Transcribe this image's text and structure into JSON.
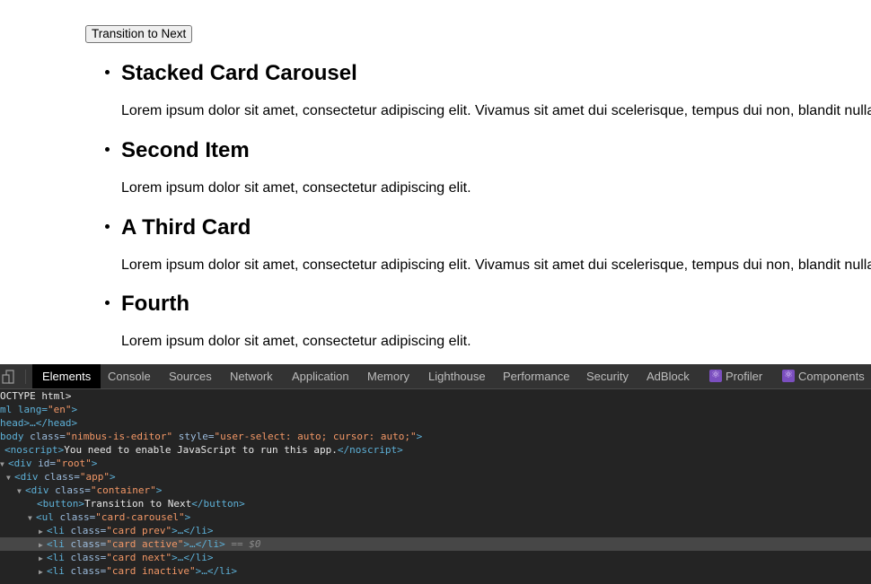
{
  "page": {
    "button_label": "Transition to Next",
    "cards": [
      {
        "title": "Stacked Card Carousel",
        "text": "Lorem ipsum dolor sit amet, consectetur adipiscing elit. Vivamus sit amet dui scelerisque, tempus dui non, blandit nulla"
      },
      {
        "title": "Second Item",
        "text": "Lorem ipsum dolor sit amet, consectetur adipiscing elit."
      },
      {
        "title": "A Third Card",
        "text": "Lorem ipsum dolor sit amet, consectetur adipiscing elit. Vivamus sit amet dui scelerisque, tempus dui non, blandit nulla"
      },
      {
        "title": "Fourth",
        "text": "Lorem ipsum dolor sit amet, consectetur adipiscing elit."
      }
    ]
  },
  "devtools": {
    "tabs": [
      {
        "label": "Elements",
        "active": true
      },
      {
        "label": "Console"
      },
      {
        "label": "Sources"
      },
      {
        "label": "Network"
      },
      {
        "label": "Application"
      },
      {
        "label": "Memory"
      },
      {
        "label": "Lighthouse"
      },
      {
        "label": "Performance"
      },
      {
        "label": "Security"
      },
      {
        "label": "AdBlock"
      },
      {
        "label": "Profiler",
        "icon": "react-icon"
      },
      {
        "label": "Components",
        "icon": "react-icon"
      }
    ],
    "tree": {
      "doctype": "OCTYPE html>",
      "html_open": "ml lang=",
      "html_lang": "\"en\"",
      "head": "head>…</head>",
      "body_tag": "body ",
      "body_class_attr": "class=",
      "body_class_val": "\"nimbus-is-editor\"",
      "body_style_attr": " style=",
      "body_style_val": "\"user-select: auto; cursor: auto;\"",
      "noscript_open": "<noscript>",
      "noscript_text": "You need to enable JavaScript to run this app.",
      "noscript_close": "</noscript>",
      "root_tag": "<div ",
      "root_attr": "id=",
      "root_val": "\"root\"",
      "app_tag": "<div ",
      "app_attr": "class=",
      "app_val": "\"app\"",
      "container_tag": "<div ",
      "container_attr": "class=",
      "container_val": "\"container\"",
      "button_open": "<button>",
      "button_text": "Transition to Next",
      "button_close": "</button>",
      "ul_tag": "<ul ",
      "ul_attr": "class=",
      "ul_val": "\"card-carousel\"",
      "li_items": [
        {
          "cls": "\"card prev\""
        },
        {
          "cls": "\"card active\"",
          "ref": "== $0"
        },
        {
          "cls": "\"card next\""
        },
        {
          "cls": "\"card inactive\""
        }
      ],
      "li_tag": "<li ",
      "li_attr": "class=",
      "li_collapsed": ">…</li>"
    }
  }
}
